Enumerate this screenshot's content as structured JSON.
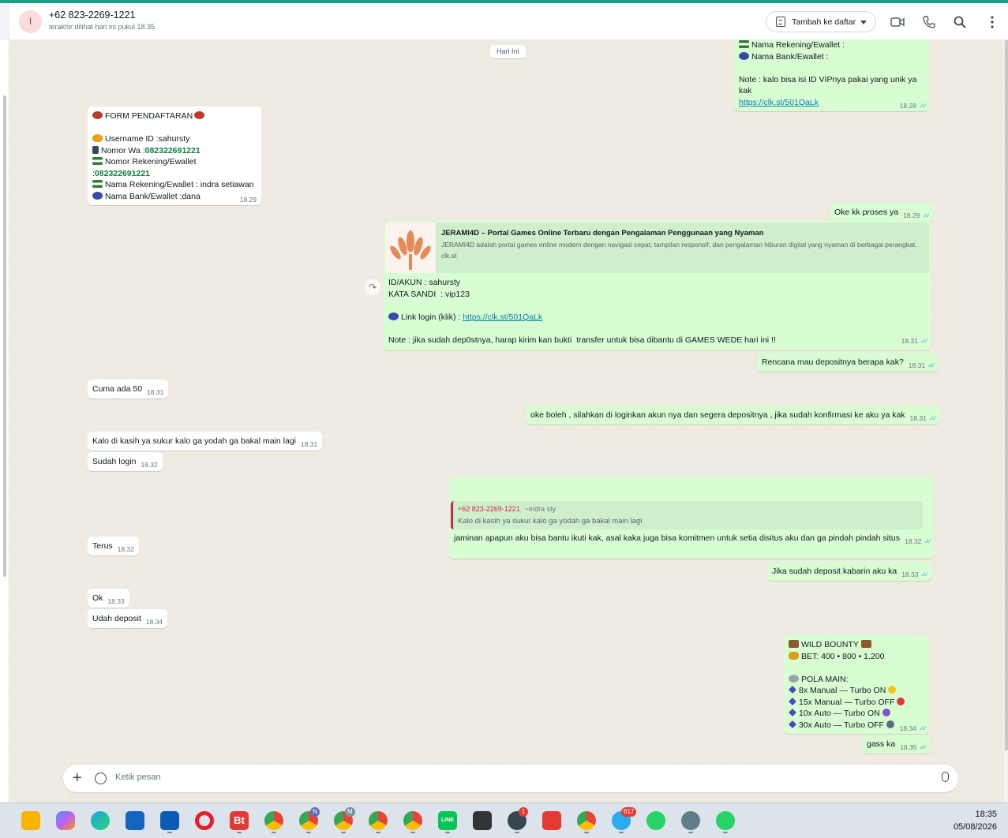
{
  "header": {
    "avatar_letter": "I",
    "contact_name": "+62 823-2269-1221",
    "contact_status": "terakhir dilihat hari ini pukul 18.35",
    "add_to_list_label": "Tambah ke daftar",
    "icons": [
      "add-to-list-icon",
      "video-call-icon",
      "voice-call-icon",
      "search-icon",
      "menu-icon"
    ]
  },
  "chat": {
    "date_chip": "Hari Ini",
    "m1": {
      "line1": "Nama Rekening/Ewallet :",
      "line2": "Nama Bank/Ewallet :",
      "note": "Note : kalo bisa isi ID VIPnya pakai yang unik ya kak",
      "link": "https://clk.st/501QaLk",
      "time": "18.28"
    },
    "m2": {
      "title": "FORM PENDAFTARAN",
      "username": "Username ID :sahursty",
      "nomor_wa_label": "Nomor Wa :",
      "nomor_wa": "082322691221",
      "rek_label": "Nomor Rekening/Ewallet  :",
      "rek": "082322691221",
      "nama_rek": "Nama Rekening/Ewallet : indra setiawan",
      "bank": "Nama Bank/Ewallet :dana",
      "time": "18.29"
    },
    "m3": {
      "text": "Oke kk proses ya",
      "time": "18.29"
    },
    "m4": {
      "preview_title": "JERAMI4D – Portal Games Online Terbaru dengan Pengalaman Penggunaan yang Nyaman",
      "preview_desc": "JERAMI4D adalah portal games online modern dengan navigasi cepat, tampilan responsif, dan pengalaman hiburan digital yang nyaman di berbagai perangkat.",
      "preview_domain": "clk.st",
      "akun": "ID/AKUN : sahursty",
      "sandi": "KATA SANDI  : vip123",
      "link_label": "Link login (klik) :",
      "link": "https://clk.st/501QaLk",
      "note": "Note : jika sudah dep0stnya, harap kirim kan bukti  transfer untuk bisa dibantu di GAMES WEDE hari ini !!",
      "time": "18.31"
    },
    "m5": {
      "text": "Rencana mau depositnya berapa kak?",
      "time": "18.31"
    },
    "m6": {
      "text": "Cuma ada 50",
      "time": "18.31"
    },
    "m7": {
      "text": "oke boleh , silahkan di loginkan akun nya dan segera depositnya , jika sudah konfirmasi ke aku ya kak",
      "time": "18.31"
    },
    "m8": {
      "text": "Kalo di kasih ya sukur kalo ga yodah ga bakal main lagi",
      "time": "18.31"
    },
    "m9": {
      "text": "Sudah login",
      "time": "18.32"
    },
    "m10": {
      "quote_name": "+62 823-2269-1221",
      "quote_alias": "~indra sty",
      "quote_text": "Kalo di kasih ya sukur kalo ga yodah ga bakal main lagi",
      "text": "jaminan apapun aku bisa bantu ikuti kak, asal kaka juga bisa komitmen untuk setia disitus aku dan ga pindah pindah situs",
      "time": "18.32"
    },
    "m11": {
      "text": "Terus",
      "time": "18.32"
    },
    "m12": {
      "text": "Jika sudah deposit kabarin aku ka",
      "time": "18.33"
    },
    "m13": {
      "text": "Ok",
      "time": "18.33"
    },
    "m14": {
      "text": "Udah deposit",
      "time": "18.34"
    },
    "m15": {
      "title": "WILD BOUNTY",
      "bet": "BET: 400 • 800 • 1.200",
      "pola": "POLA MAIN:",
      "p1": "8x Manual — Turbo ON",
      "p2": "15x Manual — Turbo OFF",
      "p3": "10x Auto — Turbo ON",
      "p4": "30x Auto — Turbo OFF",
      "time": "18.34"
    },
    "m16": {
      "text": "gass ka",
      "time": "18.35"
    }
  },
  "composer": {
    "placeholder": "Ketik pesan"
  },
  "taskbar": {
    "apps": [
      "file-explorer",
      "copilot",
      "edge",
      "outlook",
      "store",
      "opera",
      "bt",
      "chrome",
      "chrome-n",
      "chrome-m",
      "chrome-2",
      "chrome-3",
      "line",
      "sticky-notes",
      "app-badge",
      "wps",
      "chrome-4",
      "telegram",
      "whatsapp",
      "settings",
      "whatsapp-2"
    ],
    "badge_app": "1",
    "badge_telegram": "617",
    "profile_n": "N",
    "profile_m": "M",
    "line_label": "LINE",
    "bt_label": "Bt",
    "time": "18:35",
    "date": "05/08/2026"
  },
  "colors": {
    "accent": "#1f9e86",
    "outgoing": "#d9fdd3",
    "incoming": "#ffffff",
    "chat_bg": "#efeae2",
    "link": "#027eb5",
    "read_tick": "#53bdeb"
  }
}
